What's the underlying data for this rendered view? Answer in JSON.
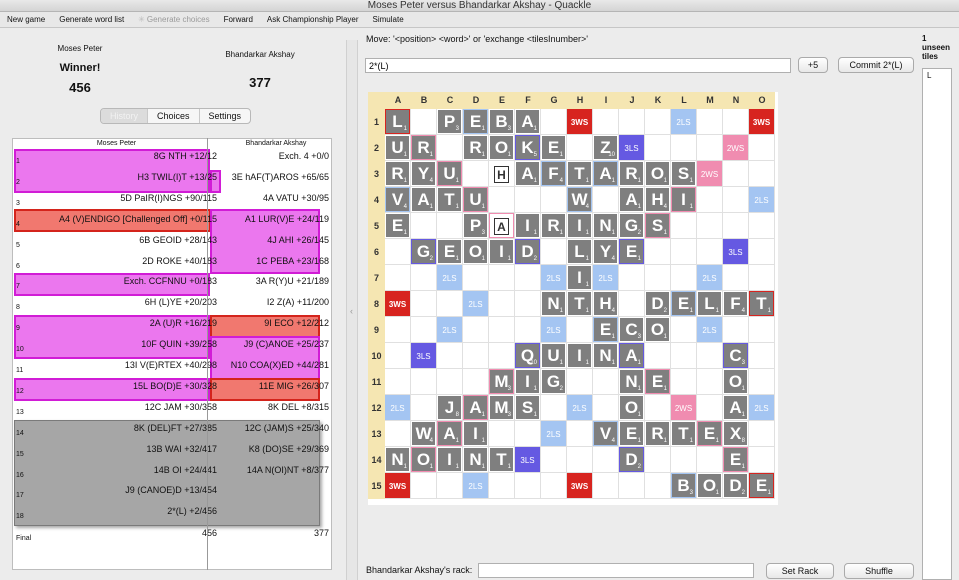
{
  "window": {
    "title": "Moses Peter versus Bhandarkar Akshay - Quackle"
  },
  "toolbar": {
    "items": [
      {
        "label": "New game",
        "enabled": true
      },
      {
        "label": "Generate word list",
        "enabled": true
      },
      {
        "label": "Generate choices",
        "enabled": false
      },
      {
        "label": "Forward",
        "enabled": true
      },
      {
        "label": "Ask Championship Player",
        "enabled": true
      },
      {
        "label": "Simulate",
        "enabled": true
      }
    ]
  },
  "scoreboard": {
    "player1": {
      "name": "Moses Peter",
      "status": "Winner!",
      "score": "456"
    },
    "player2": {
      "name": "Bhandarkar Akshay",
      "score": "377"
    }
  },
  "tabs": [
    "History",
    "Choices",
    "Settings"
  ],
  "history": {
    "headers": [
      "Moses Peter",
      "Bhandarkar Akshay"
    ],
    "rows": [
      {
        "n": "1",
        "p1": "8G NTH  +12/12",
        "p2": "Exch. 4  +0/0"
      },
      {
        "n": "2",
        "p1": "H3 TWIL(I)T  +13/25",
        "p2": "3E hAF(T)AROS  +65/65"
      },
      {
        "n": "3",
        "p1": "5D PaIR(I)NGS  +90/115",
        "p2": "4A VATU  +30/95"
      },
      {
        "n": "4",
        "p1": "A4 (V)ENDIGO [Challenged Off]  +0/115",
        "p2": "A1 LUR(V)E  +24/119"
      },
      {
        "n": "5",
        "p1": "6B GEOID  +28/143",
        "p2": "4J AHI  +26/145"
      },
      {
        "n": "6",
        "p1": "2D ROKE  +40/183",
        "p2": "1C PEBA  +23/168"
      },
      {
        "n": "7",
        "p1": "Exch. CCFNNU  +0/183",
        "p2": "3A R(Y)U  +21/189"
      },
      {
        "n": "8",
        "p1": "6H (L)YE  +20/203",
        "p2": "I2 Z(A)  +11/200"
      },
      {
        "n": "9",
        "p1": "2A (U)R  +16/219",
        "p2": "9I ECO  +12/212"
      },
      {
        "n": "10",
        "p1": "10F QUIN  +39/258",
        "p2": "J9 (C)ANOE  +25/237"
      },
      {
        "n": "11",
        "p1": "13I V(E)RTEX  +40/298",
        "p2": "N10 COA(X)ED  +44/281"
      },
      {
        "n": "12",
        "p1": "15L BO(D)E  +30/328",
        "p2": "11E MIG  +26/307"
      },
      {
        "n": "13",
        "p1": "12C JAM  +30/358",
        "p2": "8K DEL  +8/315"
      },
      {
        "n": "14",
        "p1": "8K (DEL)FT  +27/385",
        "p2": "12C (JAM)S  +25/340"
      },
      {
        "n": "15",
        "p1": "13B WAI  +32/417",
        "p2": "K8 (DO)SE  +29/369"
      },
      {
        "n": "16",
        "p1": "14B OI  +24/441",
        "p2": "14A N(OI)NT  +8/377"
      },
      {
        "n": "17",
        "p1": "J9 (CANOE)D  +13/454",
        "p2": ""
      },
      {
        "n": "18",
        "p1": "2*(L)  +2/456",
        "p2": ""
      },
      {
        "n": "Final",
        "p1": "456",
        "p2": "377"
      }
    ]
  },
  "move": {
    "label": "Move: '<position> <word>' or 'exchange <tilesInumber>'",
    "value": "2*(L)",
    "score_button": "+5",
    "commit_button": "Commit 2*(L)"
  },
  "board": {
    "columns": [
      "A",
      "B",
      "C",
      "D",
      "E",
      "F",
      "G",
      "H",
      "I",
      "J",
      "K",
      "L",
      "M",
      "N",
      "O"
    ],
    "rows": [
      "1",
      "2",
      "3",
      "4",
      "5",
      "6",
      "7",
      "8",
      "9",
      "10",
      "11",
      "12",
      "13",
      "14",
      "15"
    ],
    "premium_labels": {
      "tw": "3WS",
      "dw": "2WS",
      "tl": "3LS",
      "dl": "2LS"
    },
    "tiles": [
      {
        "r": 1,
        "c": 1,
        "l": "L",
        "p": "1"
      },
      {
        "r": 1,
        "c": 3,
        "l": "P",
        "p": "3"
      },
      {
        "r": 1,
        "c": 4,
        "l": "E",
        "p": "1"
      },
      {
        "r": 1,
        "c": 5,
        "l": "B",
        "p": "3"
      },
      {
        "r": 1,
        "c": 6,
        "l": "A",
        "p": "1"
      },
      {
        "r": 2,
        "c": 1,
        "l": "U",
        "p": "1"
      },
      {
        "r": 2,
        "c": 2,
        "l": "R",
        "p": "1"
      },
      {
        "r": 2,
        "c": 4,
        "l": "R",
        "p": "1"
      },
      {
        "r": 2,
        "c": 5,
        "l": "O",
        "p": "1"
      },
      {
        "r": 2,
        "c": 6,
        "l": "K",
        "p": "5"
      },
      {
        "r": 2,
        "c": 7,
        "l": "E",
        "p": "1"
      },
      {
        "r": 2,
        "c": 9,
        "l": "Z",
        "p": "10"
      },
      {
        "r": 3,
        "c": 1,
        "l": "R",
        "p": "1"
      },
      {
        "r": 3,
        "c": 2,
        "l": "Y",
        "p": "4"
      },
      {
        "r": 3,
        "c": 3,
        "l": "U",
        "p": "1"
      },
      {
        "r": 3,
        "c": 5,
        "l": "H",
        "p": "",
        "blank": true
      },
      {
        "r": 3,
        "c": 6,
        "l": "A",
        "p": "1"
      },
      {
        "r": 3,
        "c": 7,
        "l": "F",
        "p": "4"
      },
      {
        "r": 3,
        "c": 8,
        "l": "T",
        "p": "1"
      },
      {
        "r": 3,
        "c": 9,
        "l": "A",
        "p": "1"
      },
      {
        "r": 3,
        "c": 10,
        "l": "R",
        "p": "1"
      },
      {
        "r": 3,
        "c": 11,
        "l": "O",
        "p": "1"
      },
      {
        "r": 3,
        "c": 12,
        "l": "S",
        "p": "1"
      },
      {
        "r": 4,
        "c": 1,
        "l": "V",
        "p": "4"
      },
      {
        "r": 4,
        "c": 2,
        "l": "A",
        "p": "1"
      },
      {
        "r": 4,
        "c": 3,
        "l": "T",
        "p": "1"
      },
      {
        "r": 4,
        "c": 4,
        "l": "U",
        "p": "1"
      },
      {
        "r": 4,
        "c": 8,
        "l": "W",
        "p": "4"
      },
      {
        "r": 4,
        "c": 10,
        "l": "A",
        "p": "1"
      },
      {
        "r": 4,
        "c": 11,
        "l": "H",
        "p": "4"
      },
      {
        "r": 4,
        "c": 12,
        "l": "I",
        "p": "1"
      },
      {
        "r": 5,
        "c": 1,
        "l": "E",
        "p": "1"
      },
      {
        "r": 5,
        "c": 4,
        "l": "P",
        "p": "3"
      },
      {
        "r": 5,
        "c": 5,
        "l": "A",
        "p": "",
        "blank": true
      },
      {
        "r": 5,
        "c": 6,
        "l": "I",
        "p": "1"
      },
      {
        "r": 5,
        "c": 7,
        "l": "R",
        "p": "1"
      },
      {
        "r": 5,
        "c": 8,
        "l": "I",
        "p": "1"
      },
      {
        "r": 5,
        "c": 9,
        "l": "N",
        "p": "1"
      },
      {
        "r": 5,
        "c": 10,
        "l": "G",
        "p": "2"
      },
      {
        "r": 5,
        "c": 11,
        "l": "S",
        "p": "1"
      },
      {
        "r": 6,
        "c": 2,
        "l": "G",
        "p": "2"
      },
      {
        "r": 6,
        "c": 3,
        "l": "E",
        "p": "1"
      },
      {
        "r": 6,
        "c": 4,
        "l": "O",
        "p": "1"
      },
      {
        "r": 6,
        "c": 5,
        "l": "I",
        "p": "1"
      },
      {
        "r": 6,
        "c": 6,
        "l": "D",
        "p": "2"
      },
      {
        "r": 6,
        "c": 8,
        "l": "L",
        "p": "1"
      },
      {
        "r": 6,
        "c": 9,
        "l": "Y",
        "p": "4"
      },
      {
        "r": 6,
        "c": 10,
        "l": "E",
        "p": "1"
      },
      {
        "r": 7,
        "c": 8,
        "l": "I",
        "p": "1"
      },
      {
        "r": 8,
        "c": 7,
        "l": "N",
        "p": "1"
      },
      {
        "r": 8,
        "c": 8,
        "l": "T",
        "p": "1"
      },
      {
        "r": 8,
        "c": 9,
        "l": "H",
        "p": "4"
      },
      {
        "r": 8,
        "c": 11,
        "l": "D",
        "p": "2"
      },
      {
        "r": 8,
        "c": 12,
        "l": "E",
        "p": "1"
      },
      {
        "r": 8,
        "c": 13,
        "l": "L",
        "p": "1"
      },
      {
        "r": 8,
        "c": 14,
        "l": "F",
        "p": "4"
      },
      {
        "r": 8,
        "c": 15,
        "l": "T",
        "p": "1"
      },
      {
        "r": 9,
        "c": 9,
        "l": "E",
        "p": "1"
      },
      {
        "r": 9,
        "c": 10,
        "l": "C",
        "p": "3"
      },
      {
        "r": 9,
        "c": 11,
        "l": "O",
        "p": "1"
      },
      {
        "r": 10,
        "c": 6,
        "l": "Q",
        "p": "10"
      },
      {
        "r": 10,
        "c": 7,
        "l": "U",
        "p": "1"
      },
      {
        "r": 10,
        "c": 8,
        "l": "I",
        "p": "1"
      },
      {
        "r": 10,
        "c": 9,
        "l": "N",
        "p": "1"
      },
      {
        "r": 10,
        "c": 10,
        "l": "A",
        "p": "1"
      },
      {
        "r": 10,
        "c": 14,
        "l": "C",
        "p": "3"
      },
      {
        "r": 11,
        "c": 5,
        "l": "M",
        "p": "3"
      },
      {
        "r": 11,
        "c": 6,
        "l": "I",
        "p": "1"
      },
      {
        "r": 11,
        "c": 7,
        "l": "G",
        "p": "2"
      },
      {
        "r": 11,
        "c": 10,
        "l": "N",
        "p": "1"
      },
      {
        "r": 11,
        "c": 11,
        "l": "E",
        "p": "1"
      },
      {
        "r": 11,
        "c": 14,
        "l": "O",
        "p": "1"
      },
      {
        "r": 12,
        "c": 3,
        "l": "J",
        "p": "8"
      },
      {
        "r": 12,
        "c": 4,
        "l": "A",
        "p": "1"
      },
      {
        "r": 12,
        "c": 5,
        "l": "M",
        "p": "3"
      },
      {
        "r": 12,
        "c": 6,
        "l": "S",
        "p": "1"
      },
      {
        "r": 12,
        "c": 10,
        "l": "O",
        "p": "1"
      },
      {
        "r": 12,
        "c": 14,
        "l": "A",
        "p": "1"
      },
      {
        "r": 13,
        "c": 2,
        "l": "W",
        "p": "4"
      },
      {
        "r": 13,
        "c": 3,
        "l": "A",
        "p": "1"
      },
      {
        "r": 13,
        "c": 4,
        "l": "I",
        "p": "1"
      },
      {
        "r": 13,
        "c": 9,
        "l": "V",
        "p": "4"
      },
      {
        "r": 13,
        "c": 10,
        "l": "E",
        "p": "1"
      },
      {
        "r": 13,
        "c": 11,
        "l": "R",
        "p": "1"
      },
      {
        "r": 13,
        "c": 12,
        "l": "T",
        "p": "1"
      },
      {
        "r": 13,
        "c": 13,
        "l": "E",
        "p": "1"
      },
      {
        "r": 13,
        "c": 14,
        "l": "X",
        "p": "8"
      },
      {
        "r": 14,
        "c": 1,
        "l": "N",
        "p": "1"
      },
      {
        "r": 14,
        "c": 2,
        "l": "O",
        "p": "1"
      },
      {
        "r": 14,
        "c": 3,
        "l": "I",
        "p": "1"
      },
      {
        "r": 14,
        "c": 4,
        "l": "N",
        "p": "1"
      },
      {
        "r": 14,
        "c": 5,
        "l": "T",
        "p": "1"
      },
      {
        "r": 14,
        "c": 10,
        "l": "D",
        "p": "2"
      },
      {
        "r": 14,
        "c": 14,
        "l": "E",
        "p": "1"
      },
      {
        "r": 15,
        "c": 12,
        "l": "B",
        "p": "3"
      },
      {
        "r": 15,
        "c": 13,
        "l": "O",
        "p": "1"
      },
      {
        "r": 15,
        "c": 14,
        "l": "D",
        "p": "2"
      },
      {
        "r": 15,
        "c": 15,
        "l": "E",
        "p": "1"
      }
    ]
  },
  "rack": {
    "label": "Bhandarkar Akshay's rack:",
    "value": "",
    "set_button": "Set Rack",
    "shuffle_button": "Shuffle"
  },
  "unseen": {
    "count": "1",
    "title": "unseen tiles",
    "tiles": "L"
  },
  "colors": {
    "tile": "#7f7f7f",
    "triple_word": "#d7241f",
    "double_word": "#f08cb0",
    "triple_letter": "#6559e2",
    "double_letter": "#a4c5f2",
    "highlight": "#e85feb",
    "header": "#f5e6b2"
  }
}
